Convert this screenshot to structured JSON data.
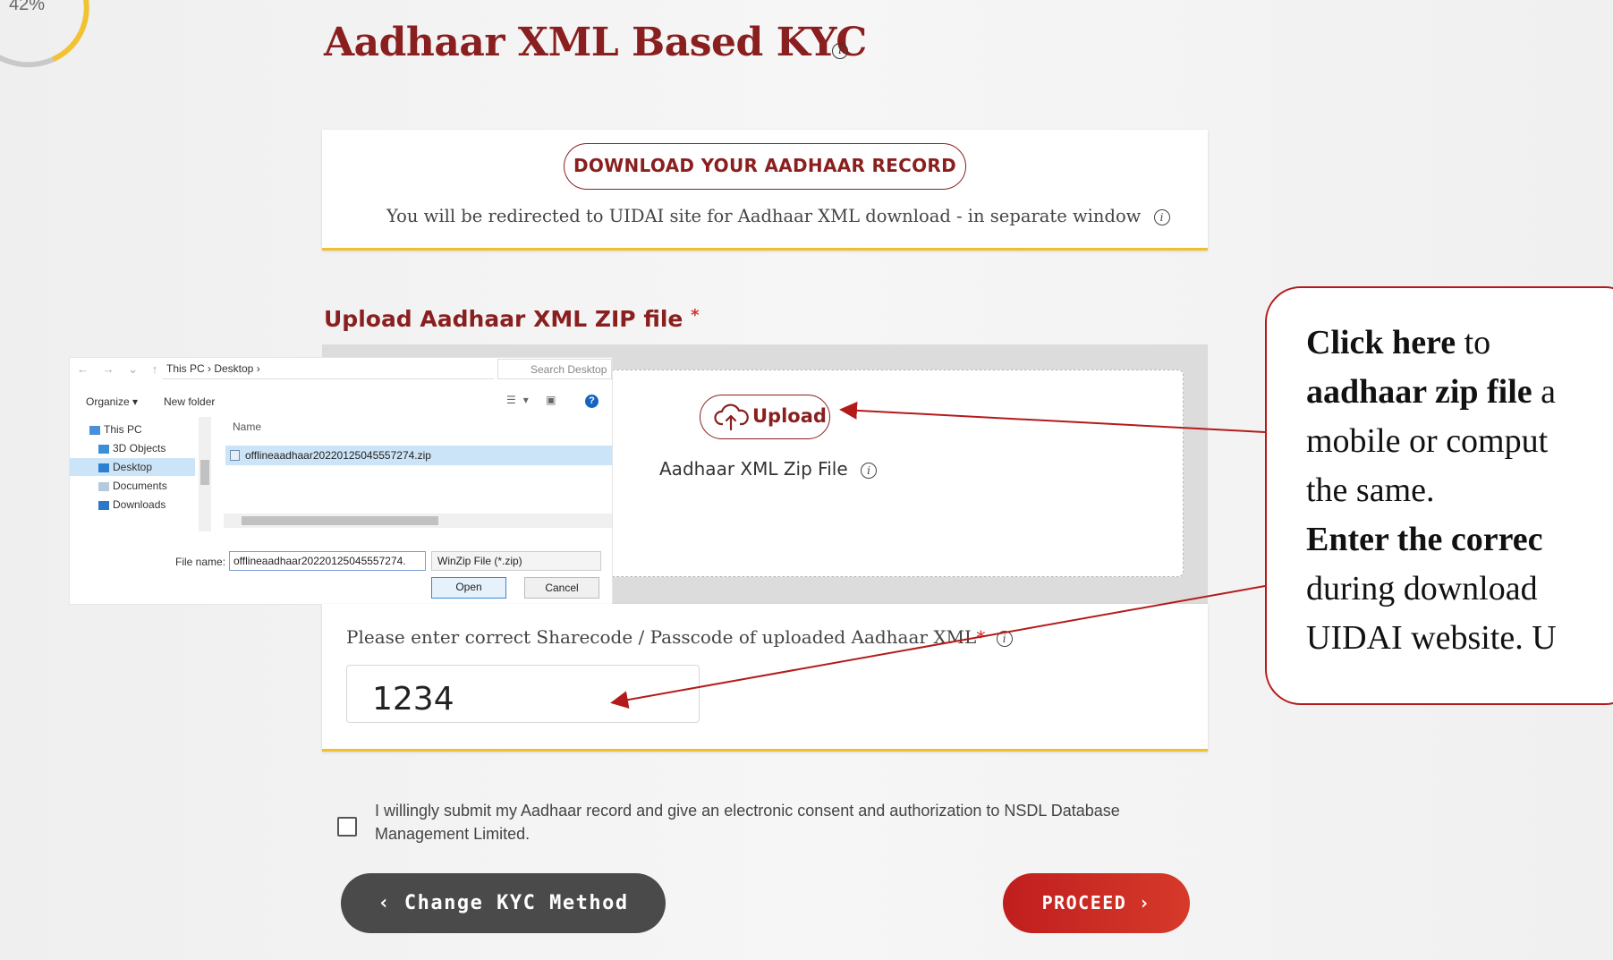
{
  "progress": {
    "percent_label": "42%",
    "value": 0.42
  },
  "page": {
    "title": "Aadhaar XML Based KYC",
    "title_info_icon": "info-icon"
  },
  "download": {
    "button_label": "DOWNLOAD YOUR AADHAAR RECORD",
    "redirect_note": "You will be redirected to UIDAI site for Aadhaar XML download - in separate window"
  },
  "upload": {
    "heading": "Upload Aadhaar XML ZIP file",
    "required_mark": "*",
    "button_label": "Upload",
    "field_label": "Aadhaar XML Zip File"
  },
  "file_dialog": {
    "breadcrumb": "This PC  ›  Desktop  ›",
    "search_placeholder": "Search Desktop",
    "organize_label": "Organize ▾",
    "new_folder_label": "New folder",
    "nav_items": [
      "This PC",
      "3D Objects",
      "Desktop",
      "Documents",
      "Downloads"
    ],
    "column_name": "Name",
    "file_name": "offlineaadhaar20220125045557274.zip",
    "filename_label": "File name:",
    "filename_value": "offlineaadhaar20220125045557274.",
    "filetype_value": "WinZip File (*.zip)",
    "open_label": "Open",
    "cancel_label": "Cancel"
  },
  "sharecode": {
    "label": "Please enter correct Sharecode / Passcode of uploaded Aadhaar XML",
    "required_mark": "*",
    "value": "1234"
  },
  "consent": {
    "text": "I willingly submit my Aadhaar record and give an electronic consent and authorization to NSDL Database Management Limited.",
    "checked": false
  },
  "buttons": {
    "change_kyc": "‹ Change KYC Method",
    "proceed": "PROCEED ›"
  },
  "callout": {
    "line1_bold": "Click here",
    "line1_rest": " to",
    "line2_bold": "aadhaar zip file",
    "line2_rest": " a",
    "line3": "mobile or comput",
    "line4": "the same.",
    "line5_bold": "Enter the correc",
    "line6": "during download",
    "line7": "UIDAI website. U"
  },
  "colors": {
    "brand": "#8a1f1f",
    "accent": "#f0bf2e",
    "proceed": "#c01e1e",
    "callout_border": "#b31b1b"
  }
}
